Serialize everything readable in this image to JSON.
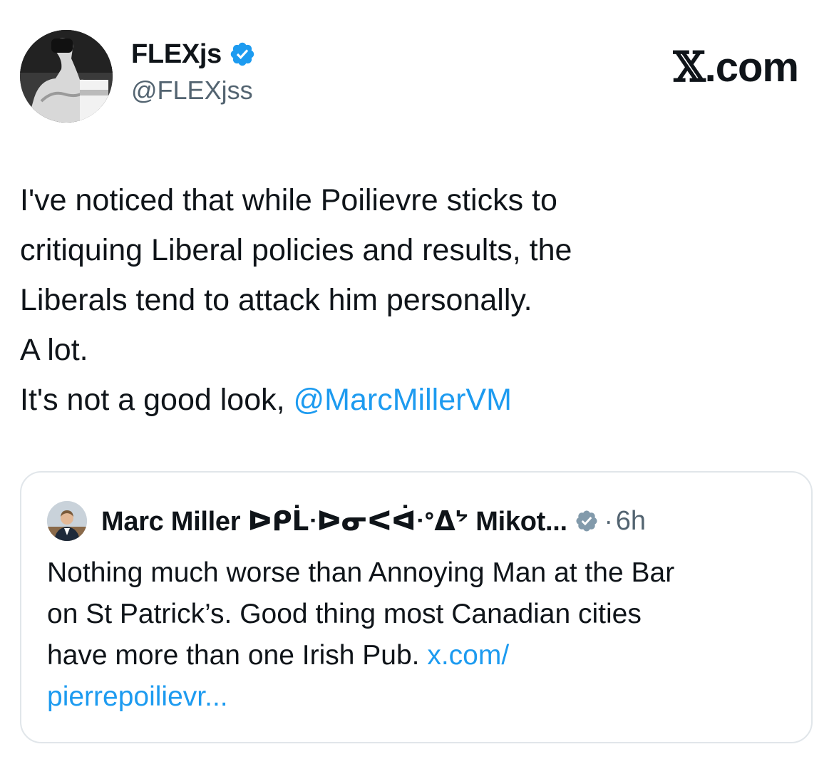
{
  "author": {
    "display_name": "FLEXjs",
    "handle": "@FLEXjss",
    "verified": true
  },
  "brand": {
    "x_glyph": "𝕏",
    "domain": ".com"
  },
  "tweet": {
    "lines": [
      "I've noticed that while Poilievre sticks to",
      "critiquing Liberal policies and results, the",
      "Liberals tend to attack him personally.",
      "A lot.",
      "It's not a good look, "
    ],
    "mention": "@MarcMillerVM"
  },
  "quoted_tweet": {
    "display_name": "Marc Miller ᐅᑭᒫᐧᐅᓂᐸᐋᐧᐤᐃᔾ Mikot...",
    "verified": true,
    "separator": "·",
    "time": "6h",
    "lines": [
      "Nothing much worse than Annoying Man at the Bar",
      "on St Patrick’s. Good thing most Canadian cities",
      "have more than one Irish Pub. "
    ],
    "link_part1": "x.com/",
    "link_part2": "pierrepoilievr..."
  },
  "colors": {
    "text": "#0f1419",
    "secondary": "#536471",
    "accent": "#1d9bf0",
    "border": "#e1e6ea"
  },
  "icons": {
    "verified": "verified-badge-icon",
    "avatar": "flexed-arm-avatar",
    "quote_avatar": "man-in-suit-avatar"
  }
}
